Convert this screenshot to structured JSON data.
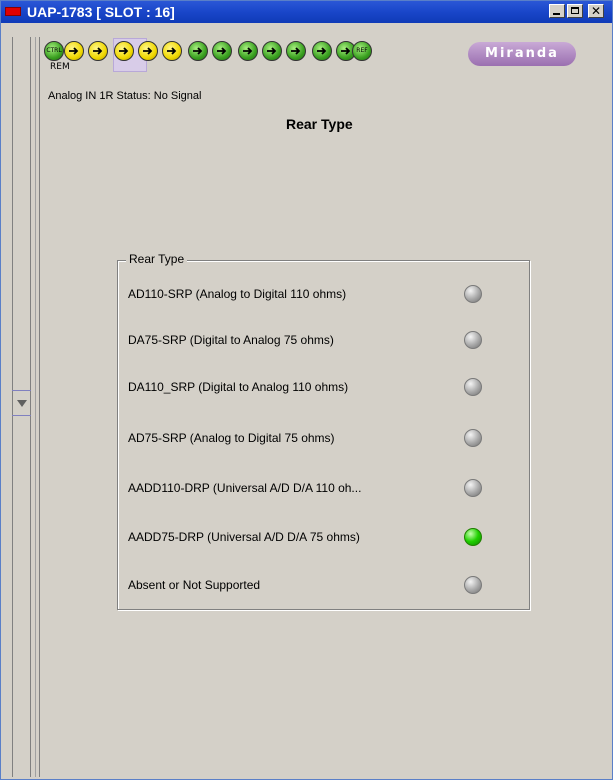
{
  "window": {
    "title": "UAP-1783 [ SLOT : 16]",
    "close_glyph": "✕"
  },
  "toolbar": {
    "ctrl_label": "CTRL",
    "rem_label": "REM",
    "ref_label": "REF",
    "logo_text": "Miranda"
  },
  "status": {
    "text": "Analog IN 1R Status: No Signal"
  },
  "page": {
    "heading": "Rear Type"
  },
  "rear_type": {
    "group_title": "Rear Type",
    "items": [
      {
        "label": "AD110-SRP (Analog to Digital 110 ohms)",
        "state": "off"
      },
      {
        "label": "DA75-SRP (Digital to Analog 75 ohms)",
        "state": "off"
      },
      {
        "label": "DA110_SRP (Digital to Analog 110 ohms)",
        "state": "off"
      },
      {
        "label": "AD75-SRP (Analog to Digital 75 ohms)",
        "state": "off"
      },
      {
        "label": "AADD110-DRP (Universal A/D D/A 110 oh...",
        "state": "off"
      },
      {
        "label": "AADD75-DRP (Universal A/D D/A 75 ohms)",
        "state": "on"
      },
      {
        "label": "Absent or Not Supported",
        "state": "off"
      }
    ]
  },
  "colors": {
    "led_on": "#20d000",
    "led_off": "#a8a8a8",
    "titlebar": "#1946c9",
    "logo": "#9a6fb0"
  }
}
